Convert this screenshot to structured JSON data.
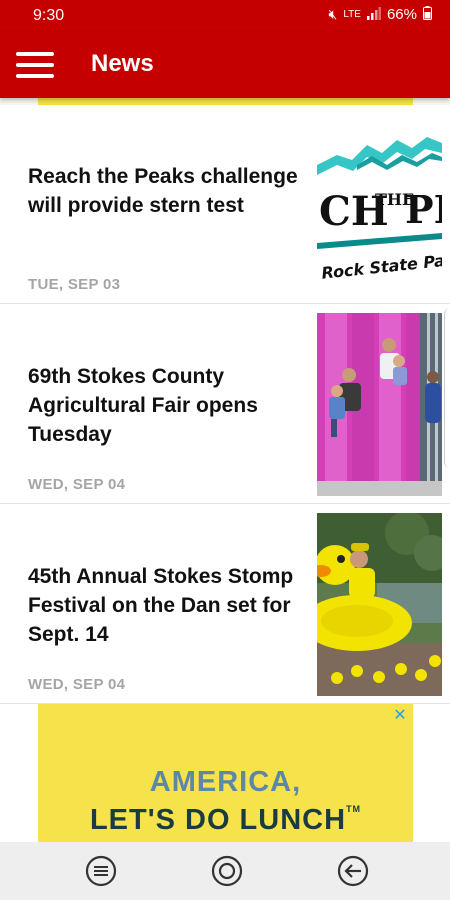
{
  "status_bar": {
    "time": "9:30",
    "battery": "66%",
    "icons": [
      "mute-icon",
      "lte-icon",
      "signal-icon",
      "battery-icon"
    ]
  },
  "app_bar": {
    "title": "News",
    "menu_icon": "hamburger-menu-icon",
    "color": "#c40000"
  },
  "news": [
    {
      "headline": "Reach the Peaks challenge will provide stern test",
      "date": "TUE, SEP 03"
    },
    {
      "headline": "69th Stokes County Agricultural Fair opens Tuesday",
      "date": "WED, SEP 04"
    },
    {
      "headline": "45th Annual Stokes Stomp Festival on the Dan set for Sept. 14",
      "date": "WED, SEP 04"
    }
  ],
  "thumb1": {
    "logo_text": "CH",
    "logo_small": "THE",
    "logo_tail": "PE",
    "subtitle": "Rock State Pa"
  },
  "ad": {
    "line1": "AMERICA,",
    "line2": "LET'S DO LUNCH",
    "tm": "TM",
    "close_icon": "close-icon",
    "background": "#f6e24a"
  },
  "nav_bar": {
    "buttons": [
      "recent-apps-icon",
      "home-icon",
      "back-icon"
    ]
  }
}
